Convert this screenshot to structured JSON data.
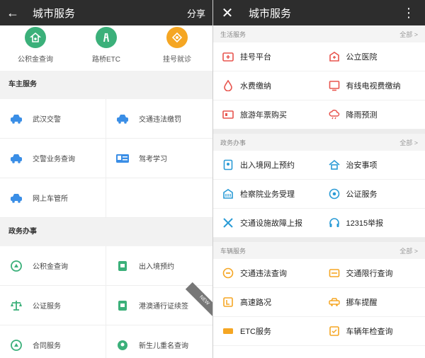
{
  "left": {
    "title": "城市服务",
    "share": "分享",
    "quick": [
      {
        "label": "公积金查询",
        "icon": "house-icon",
        "color": "#3bb07a"
      },
      {
        "label": "路桥ETC",
        "icon": "highway-icon",
        "color": "#3bb07a"
      },
      {
        "label": "挂号就诊",
        "icon": "diamond-icon",
        "color": "#f5a623"
      }
    ],
    "sections": [
      {
        "title": "车主服务",
        "items": [
          "武汉交警",
          "交通违法缴罚",
          "交警业务查询",
          "驾考学习",
          "网上车管所",
          ""
        ]
      },
      {
        "title": "政务办事",
        "items": [
          "公积金查询",
          "出入境预约",
          "公证服务",
          "港澳通行证续签",
          "合同服务",
          "新生儿重名查询"
        ]
      }
    ],
    "corner_tag": "NEW"
  },
  "right": {
    "title": "城市服务",
    "sections": [
      {
        "title": "生活服务",
        "all": "全部 >",
        "items": [
          "挂号平台",
          "公立医院",
          "水费缴纳",
          "有线电视费缴纳",
          "旅游年票购买",
          "降雨预测"
        ]
      },
      {
        "title": "政务办事",
        "all": "全部 >",
        "items": [
          "出入境网上预约",
          "治安事项",
          "检察院业务受理",
          "公证服务",
          "交通设施故障上报",
          "12315举报"
        ]
      },
      {
        "title": "车辆服务",
        "all": "全部 >",
        "items": [
          "交通违法查询",
          "交通限行查询",
          "高速路况",
          "挪车提醒",
          "ETC服务",
          "车辆年检查询"
        ]
      }
    ]
  },
  "colors": {
    "blue": "#3a8ee6",
    "green": "#3bb07a",
    "red": "#e8554e",
    "orange": "#f5a623",
    "cyan": "#2a9bd6"
  }
}
